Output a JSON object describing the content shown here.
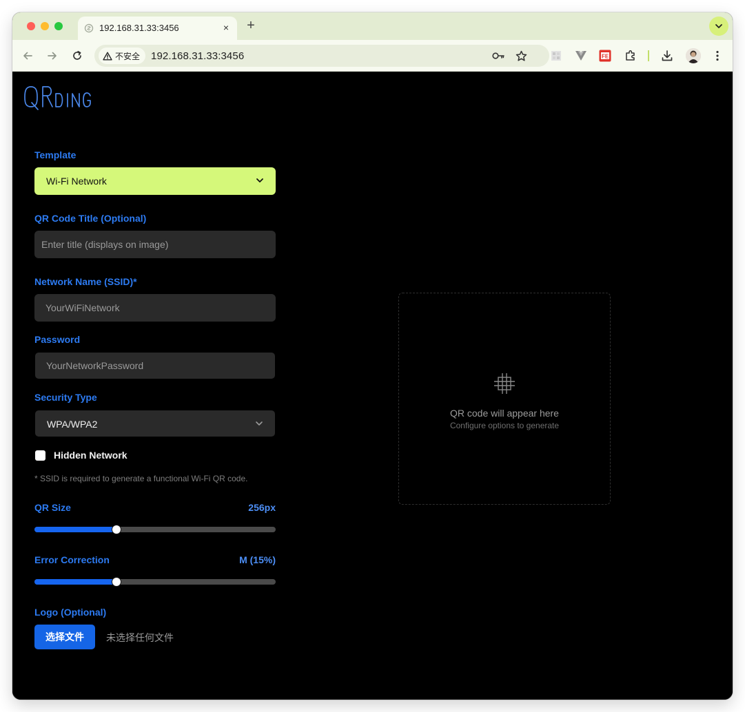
{
  "browser": {
    "tab_title": "192.168.31.33:3456",
    "new_tab_symbol": "+",
    "tab_close_symbol": "×",
    "security_chip": "不安全",
    "url": "192.168.31.33:3456"
  },
  "app": {
    "logo_text": "QRDING",
    "colors": {
      "accent": "#2d7bf2",
      "template_select_bg": "#d5f87a",
      "primary_button": "#1565e6"
    }
  },
  "form": {
    "template": {
      "label": "Template",
      "value": "Wi-Fi Network"
    },
    "title": {
      "label": "QR Code Title (Optional)",
      "placeholder": "Enter title (displays on image)"
    },
    "ssid": {
      "label": "Network Name (SSID)*",
      "placeholder": "YourWiFiNetwork"
    },
    "password": {
      "label": "Password",
      "placeholder": "YourNetworkPassword"
    },
    "security": {
      "label": "Security Type",
      "value": "WPA/WPA2"
    },
    "hidden": {
      "label": "Hidden Network",
      "checked": false
    },
    "hint": "* SSID is required to generate a functional Wi-Fi QR code.",
    "size": {
      "label": "QR Size",
      "value_text": "256px",
      "level": 0.34
    },
    "error_correction": {
      "label": "Error Correction",
      "value_text": "M (15%)",
      "level": 0.34
    },
    "logo": {
      "label": "Logo (Optional)",
      "button": "选择文件",
      "status": "未选择任何文件"
    }
  },
  "preview": {
    "title": "QR code will appear here",
    "subtitle": "Configure options to generate"
  }
}
